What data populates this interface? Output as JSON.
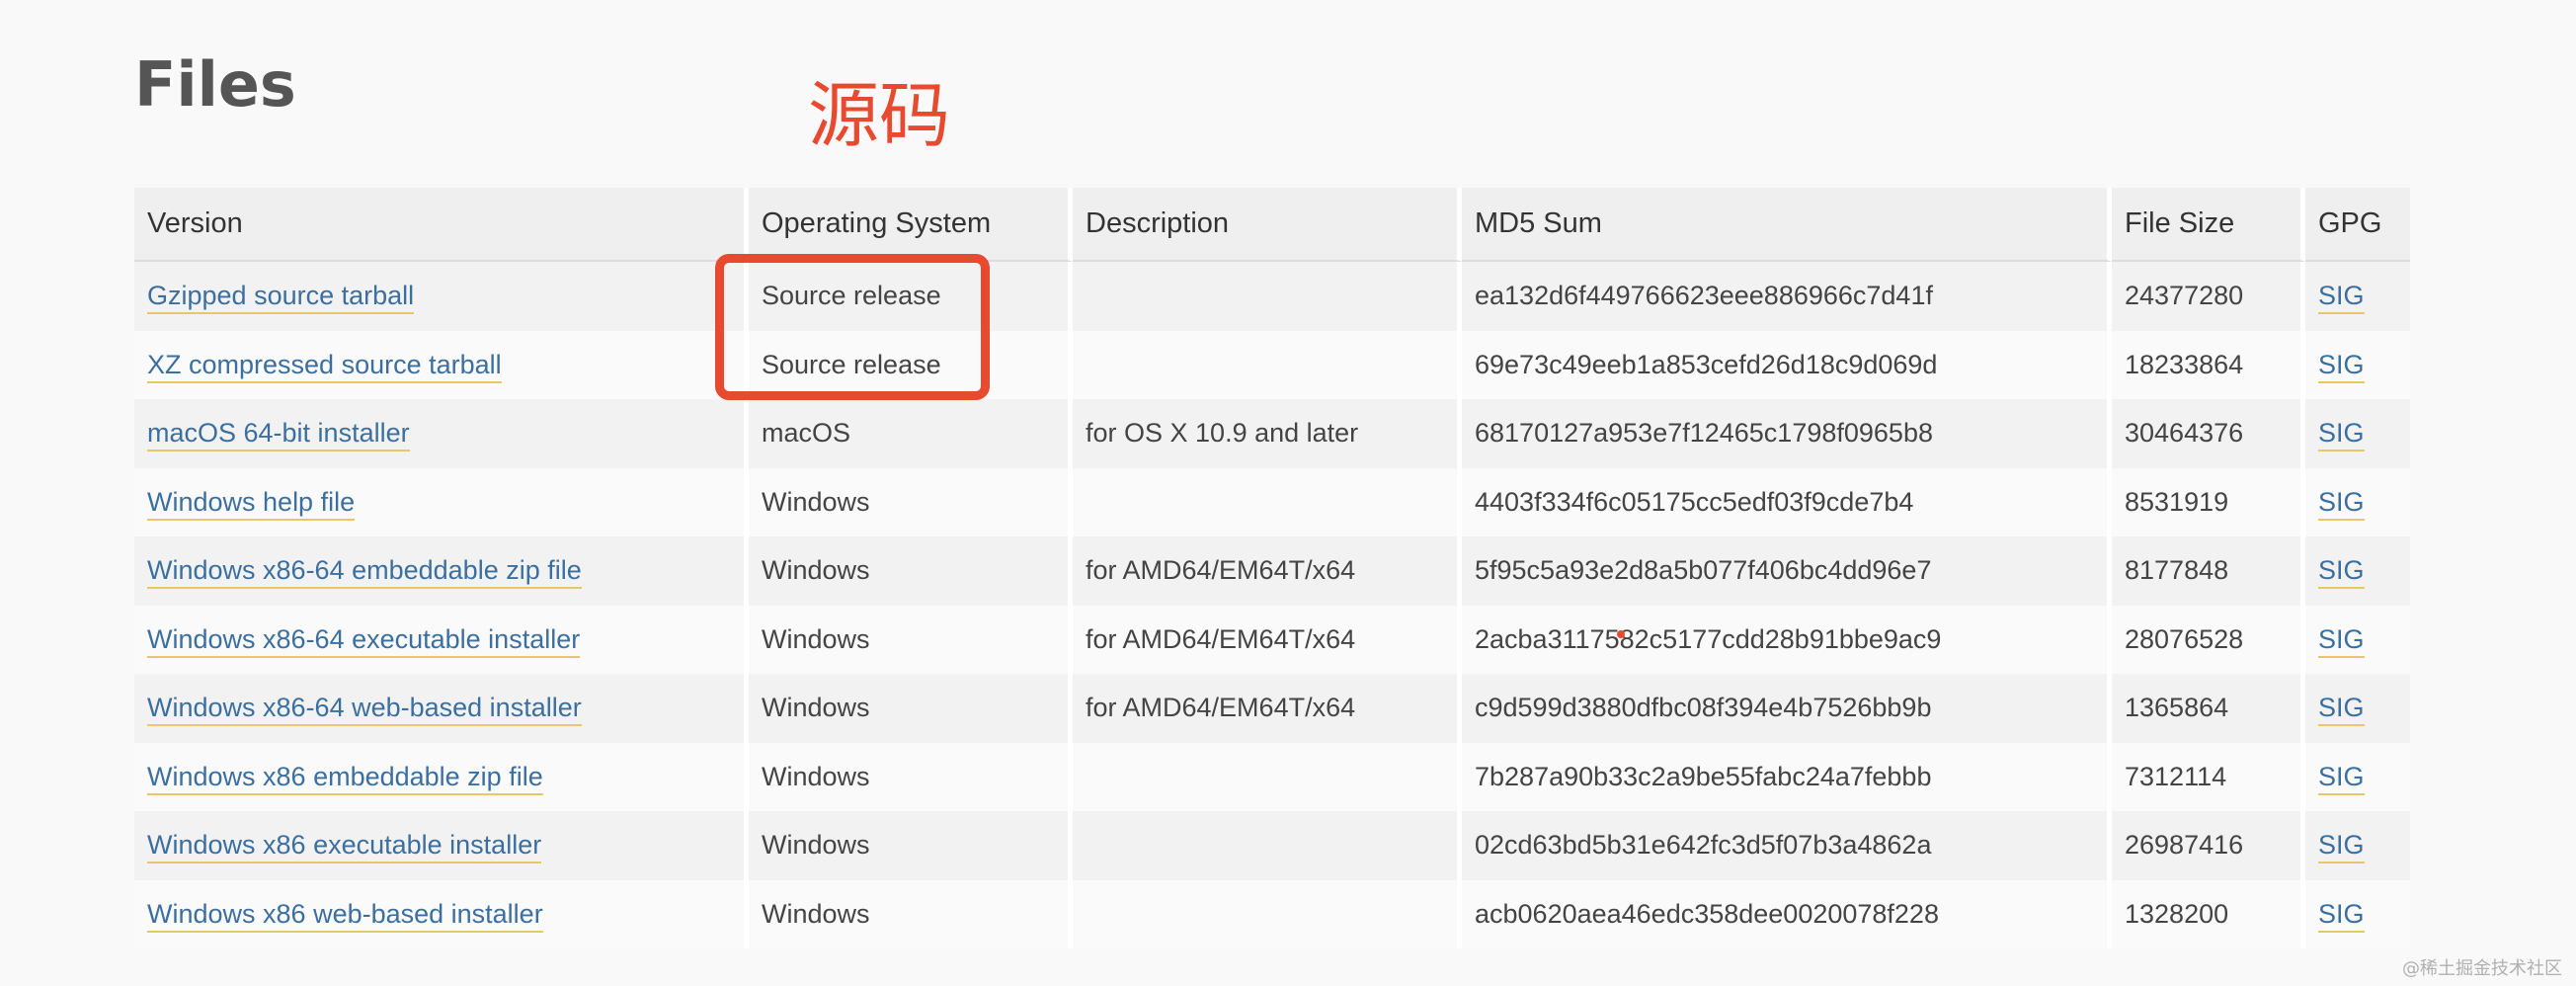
{
  "page": {
    "title": "Files",
    "annotation_label": "源码",
    "watermark": "@稀土掘金技术社区"
  },
  "colors": {
    "link": "#3b6fa0",
    "link_underline": "#e8c766",
    "annotation": "#e84a30"
  },
  "table": {
    "headers": {
      "version": "Version",
      "os": "Operating System",
      "description": "Description",
      "md5": "MD5 Sum",
      "size": "File Size",
      "gpg": "GPG"
    },
    "rows": [
      {
        "version": "Gzipped source tarball",
        "os": "Source release",
        "description": "",
        "md5": "ea132d6f449766623eee886966c7d41f",
        "size": "24377280",
        "gpg": "SIG"
      },
      {
        "version": "XZ compressed source tarball",
        "os": "Source release",
        "description": "",
        "md5": "69e73c49eeb1a853cefd26d18c9d069d",
        "size": "18233864",
        "gpg": "SIG"
      },
      {
        "version": "macOS 64-bit installer",
        "os": "macOS",
        "description": "for OS X 10.9 and later",
        "md5": "68170127a953e7f12465c1798f0965b8",
        "size": "30464376",
        "gpg": "SIG"
      },
      {
        "version": "Windows help file",
        "os": "Windows",
        "description": "",
        "md5": "4403f334f6c05175cc5edf03f9cde7b4",
        "size": "8531919",
        "gpg": "SIG"
      },
      {
        "version": "Windows x86-64 embeddable zip file",
        "os": "Windows",
        "description": "for AMD64/EM64T/x64",
        "md5": "5f95c5a93e2d8a5b077f406bc4dd96e7",
        "size": "8177848",
        "gpg": "SIG"
      },
      {
        "version": "Windows x86-64 executable installer",
        "os": "Windows",
        "description": "for AMD64/EM64T/x64",
        "md5": "2acba3117582c5177cdd28b91bbe9ac9",
        "size": "28076528",
        "gpg": "SIG"
      },
      {
        "version": "Windows x86-64 web-based installer",
        "os": "Windows",
        "description": "for AMD64/EM64T/x64",
        "md5": "c9d599d3880dfbc08f394e4b7526bb9b",
        "size": "1365864",
        "gpg": "SIG"
      },
      {
        "version": "Windows x86 embeddable zip file",
        "os": "Windows",
        "description": "",
        "md5": "7b287a90b33c2a9be55fabc24a7febbb",
        "size": "7312114",
        "gpg": "SIG"
      },
      {
        "version": "Windows x86 executable installer",
        "os": "Windows",
        "description": "",
        "md5": "02cd63bd5b31e642fc3d5f07b3a4862a",
        "size": "26987416",
        "gpg": "SIG"
      },
      {
        "version": "Windows x86 web-based installer",
        "os": "Windows",
        "description": "",
        "md5": "acb0620aea46edc358dee0020078f228",
        "size": "1328200",
        "gpg": "SIG"
      }
    ]
  }
}
